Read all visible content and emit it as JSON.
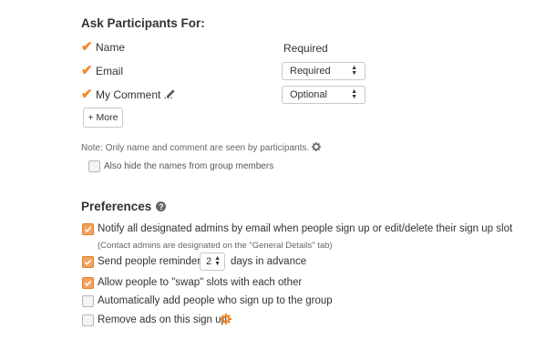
{
  "ask_section": {
    "heading": "Ask Participants For:",
    "fields": [
      {
        "label": "Name",
        "checked": true,
        "requirement": "Required",
        "type": "text"
      },
      {
        "label": "Email",
        "checked": true,
        "requirement": "Required",
        "type": "select"
      },
      {
        "label": "My Comment ...",
        "checked": true,
        "requirement": "Optional",
        "type": "select",
        "editable": true
      }
    ],
    "more_button": "+ More",
    "note": "Note: Only name and comment are seen by participants.",
    "hide_names": {
      "label": "Also hide the names from group members",
      "checked": false
    }
  },
  "preferences": {
    "heading": "Preferences",
    "items": [
      {
        "label": "Notify all designated admins by email when people sign up or edit/delete their sign up slot",
        "checked": true,
        "sub_note": "(Contact admins are designated on the \"General Details\" tab)"
      },
      {
        "label_before": "Send people reminders",
        "value": "2",
        "label_after": "days in advance",
        "checked": true
      },
      {
        "label": "Allow people to \"swap\" slots with each other",
        "checked": true
      },
      {
        "label": "Automatically add people who sign up to the group",
        "checked": false
      },
      {
        "label": "Remove ads on this sign up",
        "checked": false
      }
    ]
  },
  "colors": {
    "accent": "#f08a24",
    "checkbox_checked": "#f5a15e"
  },
  "icons": {
    "check": "checkmark-icon",
    "edit": "pencil-icon",
    "settings": "gear-icon",
    "help": "question-icon"
  }
}
